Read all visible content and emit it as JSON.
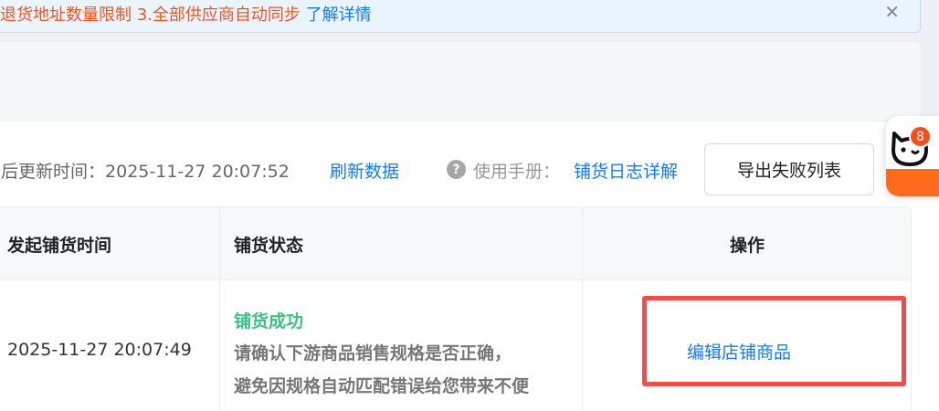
{
  "notice": {
    "prefix_warning": "退货地址数量限制  3.全部供应商自动同步",
    "link": "了解详情",
    "close_icon": "close-icon"
  },
  "toolbar": {
    "updated_label": "最后更新时间：",
    "updated_time": "2025-11-27 20:07:52",
    "refresh_label": "刷新数据",
    "help_icon": "question-circle-icon",
    "help_glyph": "?",
    "manual_label": "使用手册：",
    "manual_link": "铺货日志详解",
    "export_button": "导出失败列表"
  },
  "assistant": {
    "icon": "cat-face-icon",
    "badge_count": "8",
    "accent_color": "#ff6b1e"
  },
  "table": {
    "columns": [
      "发起铺货时间",
      "铺货状态",
      "操作"
    ],
    "rows": [
      {
        "time": "2025-11-27 20:07:49",
        "status_title": "铺货成功",
        "status_desc_1": "请确认下游商品销售规格是否正确，",
        "status_desc_2": "避免因规格自动匹配错误给您带来不便",
        "action": "编辑店铺商品"
      }
    ]
  },
  "colors": {
    "link": "#1677ff",
    "success": "#3fbf83",
    "warning": "#f5521b",
    "highlight": "#f24b4b"
  }
}
